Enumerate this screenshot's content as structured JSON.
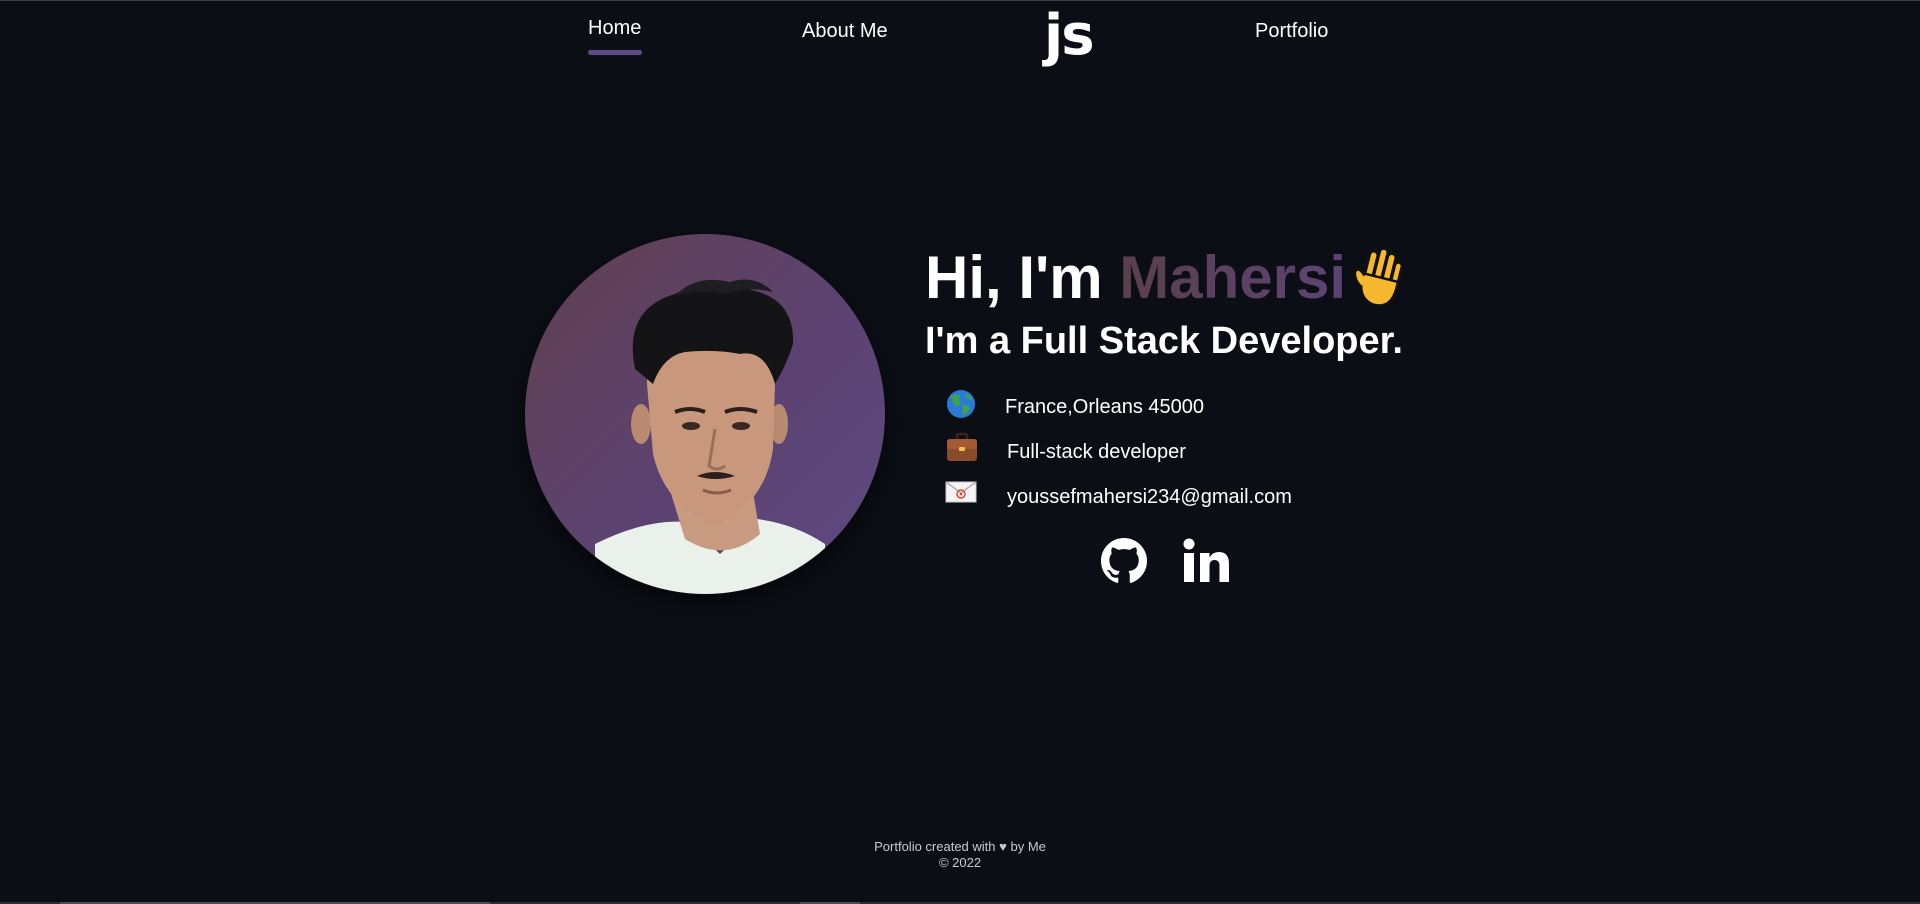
{
  "nav": {
    "home_label": "Home",
    "about_label": "About Me",
    "logo_text": "js",
    "portfolio_label": "Portfolio",
    "active_indicator_color": "#5e4a87"
  },
  "hero": {
    "greeting": "Hi, I'm ",
    "name": "Mahersi",
    "wave_icon": "waving-hand-icon",
    "subtitle": "I'm a Full Stack Developer."
  },
  "info": [
    {
      "icon": "globe-icon",
      "text": "France,Orleans 45000"
    },
    {
      "icon": "briefcase-icon",
      "text": "Full-stack developer"
    },
    {
      "icon": "envelope-icon",
      "text": "youssefmahersi234@gmail.com"
    }
  ],
  "social": [
    {
      "icon": "github-icon"
    },
    {
      "icon": "linkedin-icon"
    }
  ],
  "footer": {
    "before_heart": "Portfolio created with ",
    "heart": "♥",
    "after_heart": " by Me",
    "copyright": "© 2022"
  },
  "colors": {
    "background": "#0b0e15",
    "accent": "#5c4374",
    "avatar_gradient_start": "#61404f",
    "avatar_gradient_end": "#5e4a82"
  }
}
